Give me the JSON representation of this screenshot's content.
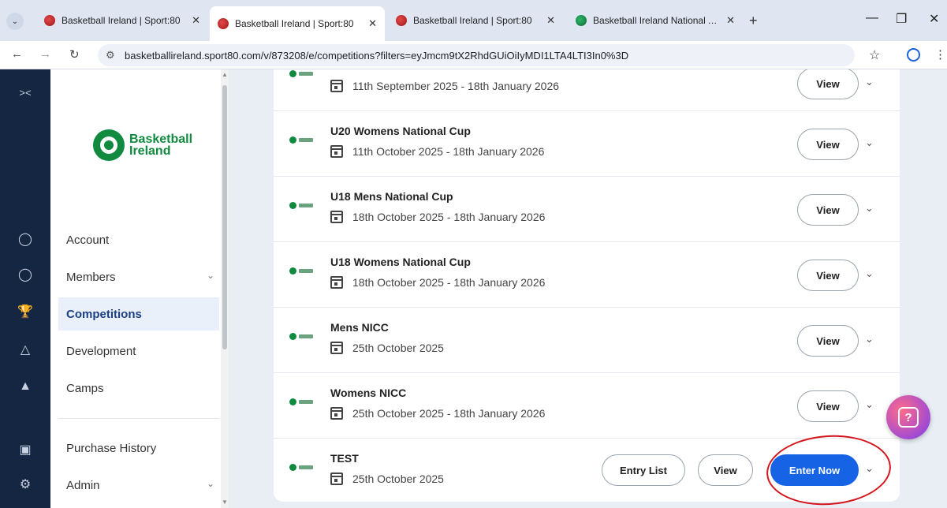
{
  "browser": {
    "tabs": [
      {
        "title": "Basketball Ireland | Sport:80",
        "favicon": "basketball-icon"
      },
      {
        "title": "Basketball Ireland | Sport:80",
        "favicon": "basketball-icon"
      },
      {
        "title": "Basketball Ireland | Sport:80",
        "favicon": "basketball-icon"
      },
      {
        "title": "Basketball Ireland National Are",
        "favicon": "basketball-ireland-logo-icon"
      }
    ],
    "new_tab": "+",
    "url": "basketballireland.sport80.com/v/873208/e/competitions?filters=eyJmcm9tX2RhdGUiOiIyMDI1LTA4LTI3In0%3D"
  },
  "sidebar": {
    "logo_line1": "Basketball",
    "logo_line2": "Ireland",
    "items": [
      {
        "label": "Account"
      },
      {
        "label": "Members"
      },
      {
        "label": "Competitions"
      },
      {
        "label": "Development"
      },
      {
        "label": "Camps"
      },
      {
        "label": "Purchase History"
      },
      {
        "label": "Admin"
      }
    ]
  },
  "competitions": [
    {
      "name": "",
      "date": "11th September 2025 - 18th January 2026",
      "view": "View"
    },
    {
      "name": "U20 Womens National Cup",
      "date": "11th October 2025 - 18th January 2026",
      "view": "View"
    },
    {
      "name": "U18 Mens National Cup",
      "date": "18th October 2025 - 18th January 2026",
      "view": "View"
    },
    {
      "name": "U18 Womens National Cup",
      "date": "18th October 2025 - 18th January 2026",
      "view": "View"
    },
    {
      "name": "Mens NICC",
      "date": "25th October 2025",
      "view": "View"
    },
    {
      "name": "Womens NICC",
      "date": "25th October 2025 - 18th January 2026",
      "view": "View"
    },
    {
      "name": "TEST",
      "date": "25th October 2025",
      "view": "View",
      "entry_list": "Entry List",
      "enter_now": "Enter Now"
    }
  ],
  "colors": {
    "rail": "#152642",
    "accent": "#1763e6",
    "brand_green": "#0f8a3e",
    "annotation": "#d6141c"
  }
}
